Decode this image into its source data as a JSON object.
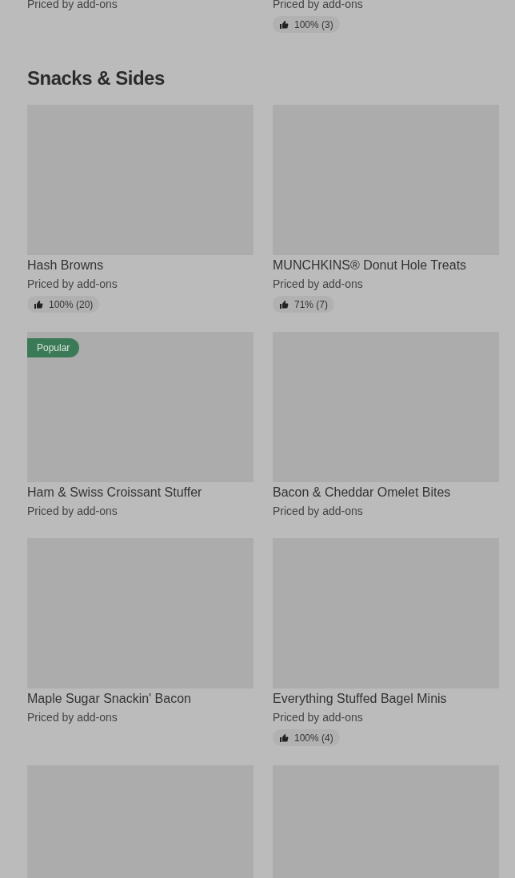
{
  "previous_section_items": [
    {
      "price": "Priced by add-ons"
    },
    {
      "price": "Priced by add-ons",
      "rating": "100% (3)"
    }
  ],
  "section": {
    "title": "Snacks & Sides",
    "items": [
      {
        "kind": "item",
        "name": "Hash Browns",
        "price": "Priced by add-ons",
        "rating": "100% (20)"
      },
      {
        "kind": "item",
        "name": "MUNCHKINS® Donut Hole Treats",
        "price": "Priced by add-ons",
        "rating": "71% (7)"
      },
      {
        "kind": "item",
        "badge": "Popular",
        "name": "Ham & Swiss Croissant Stuffer",
        "price": "Priced by add-ons"
      },
      {
        "kind": "item",
        "name": "Bacon & Cheddar Omelet Bites",
        "price": "Priced by add-ons"
      },
      {
        "kind": "item",
        "name": "Maple Sugar Snackin' Bacon",
        "price": "Priced by add-ons"
      },
      {
        "kind": "item",
        "name": "Everything Stuffed Bagel Minis",
        "price": "Priced by add-ons",
        "rating": "100% (4)"
      },
      {
        "kind": "image_only"
      },
      {
        "kind": "image_only"
      }
    ]
  }
}
